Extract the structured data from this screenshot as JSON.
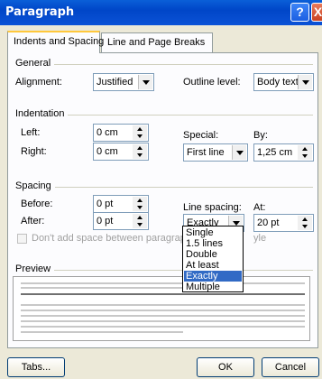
{
  "window": {
    "title": "Paragraph",
    "help_glyph": "?",
    "close_glyph": "X"
  },
  "tabs": [
    {
      "label": "Indents and Spacing",
      "underline_char": "I",
      "active": true
    },
    {
      "label": "Line and Page Breaks",
      "underline_char": "P",
      "active": false
    }
  ],
  "general": {
    "heading": "General",
    "alignment_label": "Alignment:",
    "alignment_value": "Justified",
    "outline_label": "Outline level:",
    "outline_value": "Body text"
  },
  "indentation": {
    "heading": "Indentation",
    "left_label": "Left:",
    "left_value": "0 cm",
    "right_label": "Right:",
    "right_value": "0 cm",
    "special_label": "Special:",
    "special_value": "First line",
    "by_label": "By:",
    "by_value": "1,25 cm"
  },
  "spacing": {
    "heading": "Spacing",
    "before_label": "Before:",
    "before_value": "0 pt",
    "after_label": "After:",
    "after_value": "0 pt",
    "line_spacing_label": "Line spacing:",
    "line_spacing_value": "Exactly",
    "at_label": "At:",
    "at_value": "20 pt",
    "dont_add_label": "Don't add space between paragraph",
    "dont_add_tail": "yle"
  },
  "line_spacing_options": [
    "Single",
    "1.5 lines",
    "Double",
    "At least",
    "Exactly",
    "Multiple"
  ],
  "line_spacing_selected_index": 4,
  "preview": {
    "heading": "Preview"
  },
  "buttons": {
    "tabs": "Tabs...",
    "ok": "OK",
    "cancel": "Cancel"
  },
  "colors": {
    "titlebar": "#0a5fd8",
    "selection": "#316ac5",
    "dialog_bg": "#ece9d8"
  }
}
